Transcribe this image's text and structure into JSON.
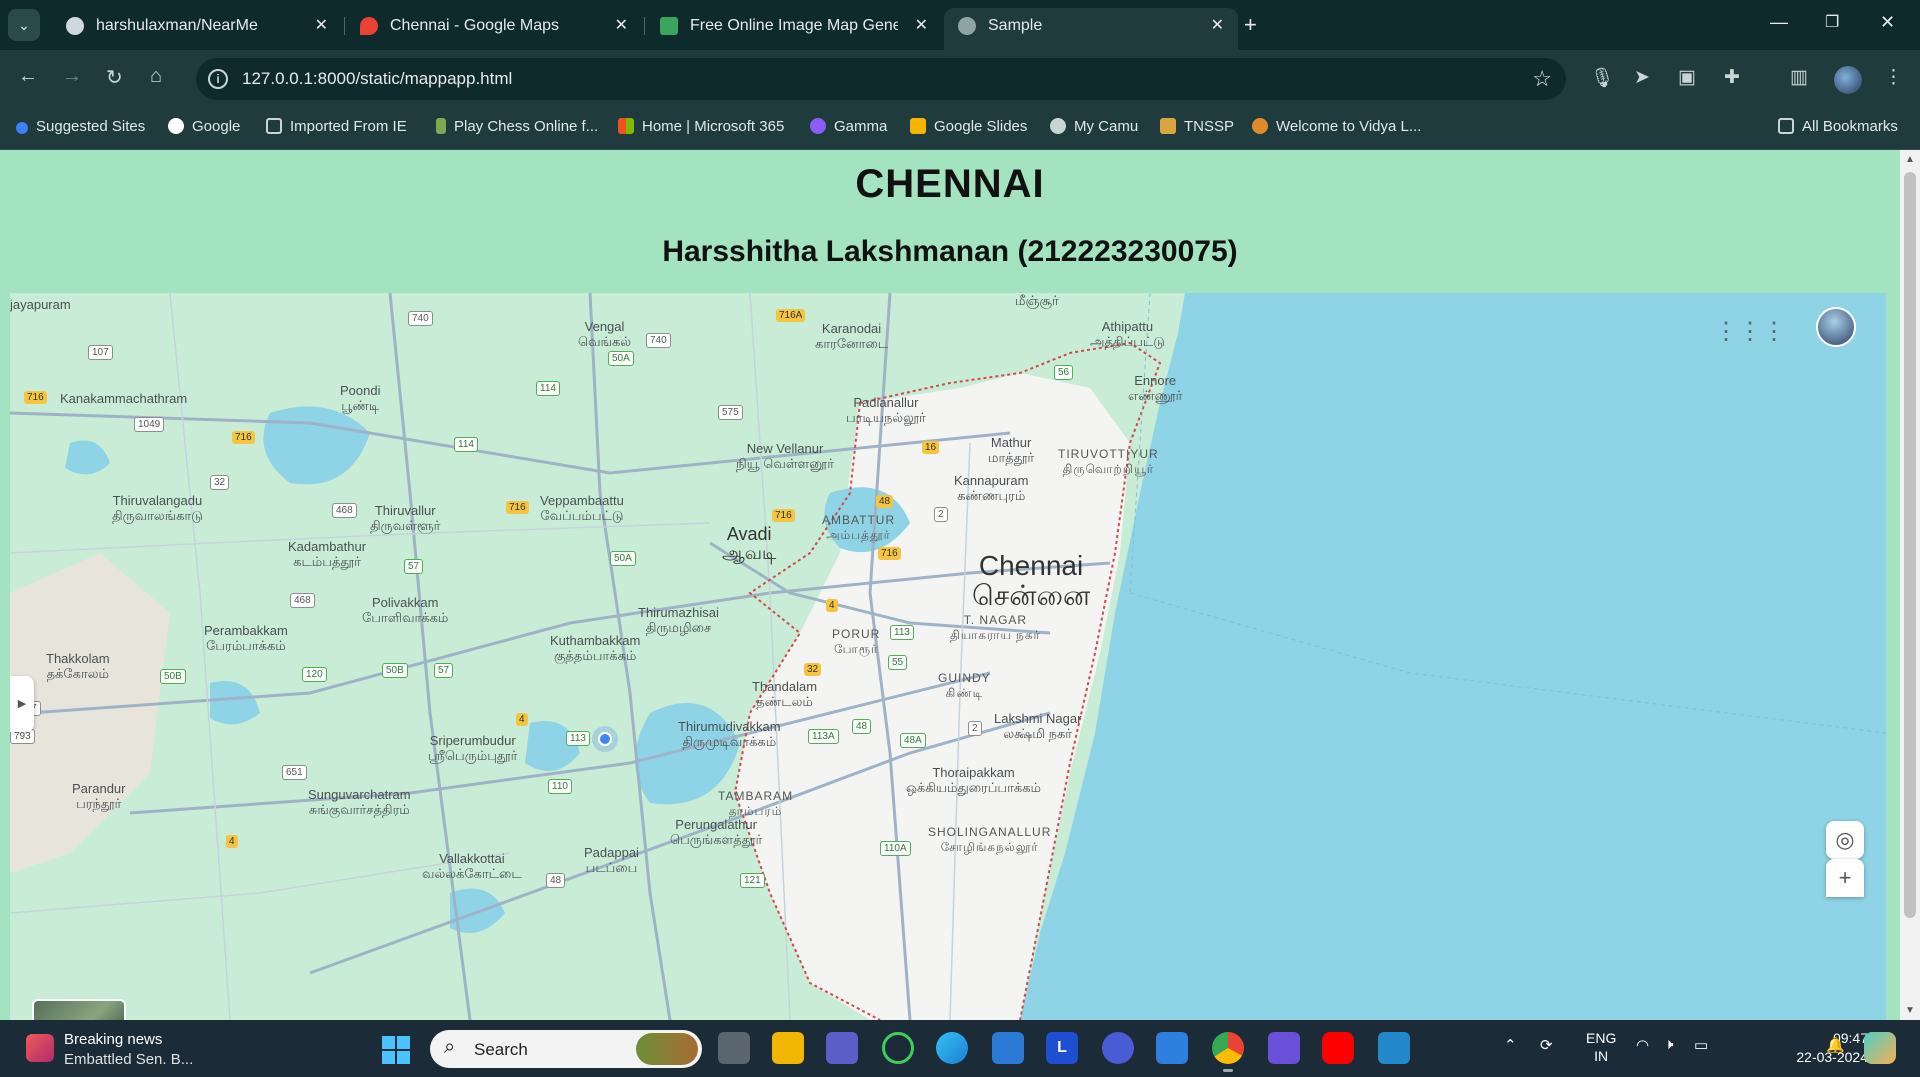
{
  "browser": {
    "tabs": [
      {
        "title": "harshulaxman/NearMe",
        "icon": "github-icon",
        "active": false
      },
      {
        "title": "Chennai - Google Maps",
        "icon": "google-maps-icon",
        "active": false
      },
      {
        "title": "Free Online Image Map Genera",
        "icon": "image-map-icon",
        "active": false
      },
      {
        "title": "Sample",
        "icon": "globe-icon",
        "active": true
      }
    ],
    "url": "127.0.0.1:8000/static/mappapp.html",
    "bookmarks": [
      {
        "label": "Suggested Sites",
        "icon": "ie-icon"
      },
      {
        "label": "Google",
        "icon": "google-icon"
      },
      {
        "label": "Imported From IE",
        "icon": "folder-icon"
      },
      {
        "label": "Play Chess Online f...",
        "icon": "chess-icon"
      },
      {
        "label": "Home | Microsoft 365",
        "icon": "microsoft-icon"
      },
      {
        "label": "Gamma",
        "icon": "gamma-icon"
      },
      {
        "label": "Google Slides",
        "icon": "slides-icon"
      },
      {
        "label": "My Camu",
        "icon": "camu-icon"
      },
      {
        "label": "TNSSP",
        "icon": "tnssp-icon"
      },
      {
        "label": "Welcome to Vidya L...",
        "icon": "vidya-icon"
      }
    ],
    "all_bookmarks": "All Bookmarks"
  },
  "page": {
    "title": "CHENNAI",
    "subtitle": "Harsshitha Lakshmanan (212223230075)"
  },
  "map": {
    "city": {
      "name": "Chennai",
      "tamil": "சென்னை"
    },
    "places": [
      {
        "en": "Avadi",
        "ta": "ஆவடி"
      },
      {
        "en": "jayapuram",
        "ta": ""
      },
      {
        "en": "Vengal",
        "ta": "வெங்கல்"
      },
      {
        "en": "Karanodai",
        "ta": "காரனோடை"
      },
      {
        "en": "Athipattu",
        "ta": "அத்திப்பட்டு"
      },
      {
        "en": "Ennore",
        "ta": "எண்ணூர்"
      },
      {
        "en": "Poondi",
        "ta": "பூண்டி"
      },
      {
        "en": "Kanakammachathram",
        "ta": ""
      },
      {
        "en": "Padianallur",
        "ta": "பாடியநல்லூர்"
      },
      {
        "en": "Mathur",
        "ta": "மாத்தூர்"
      },
      {
        "en": "TIRUVOTTIYUR",
        "ta": "திருவொற்றியூர்"
      },
      {
        "en": "New Vellanur",
        "ta": "நியூ வெள்ளனூர்"
      },
      {
        "en": "Kannapuram",
        "ta": "கண்ணபுரம்"
      },
      {
        "en": "Thiruvalangadu",
        "ta": "திருவாலங்காடு"
      },
      {
        "en": "Thiruvallur",
        "ta": "திருவள்ளூர்"
      },
      {
        "en": "Veppambaattu",
        "ta": "வேப்பம்பட்டு"
      },
      {
        "en": "AMBATTUR",
        "ta": "அம்பத்தூர்"
      },
      {
        "en": "Kadambathur",
        "ta": "கடம்பத்தூர்"
      },
      {
        "en": "Polivakkam",
        "ta": "போளிவாக்கம்"
      },
      {
        "en": "Thirumazhisai",
        "ta": "திருமழிசை"
      },
      {
        "en": "Perambakkam",
        "ta": "பேரம்பாக்கம்"
      },
      {
        "en": "Kuthambakkam",
        "ta": "குத்தம்பாக்கம்"
      },
      {
        "en": "PORUR",
        "ta": "போரூர்"
      },
      {
        "en": "T. NAGAR",
        "ta": "தியாகராய நகர்"
      },
      {
        "en": "Thakkolam",
        "ta": "தக்கோலம்"
      },
      {
        "en": "Thandalam",
        "ta": "தண்டலம்"
      },
      {
        "en": "GUINDY",
        "ta": "கிண்டி"
      },
      {
        "en": "Sriperumbudur",
        "ta": "ஸ்ரீபெரும்புதூர்"
      },
      {
        "en": "Thirumudivakkam",
        "ta": "திருமுடிவாக்கம்"
      },
      {
        "en": "Lakshmi Nagar",
        "ta": "லக்ஷ்மி நகர்"
      },
      {
        "en": "Parandur",
        "ta": "பரந்தூர்"
      },
      {
        "en": "Sunguvarchatram",
        "ta": "சுங்குவார்சத்திரம்"
      },
      {
        "en": "Thoraipakkam",
        "ta": "ஒக்கியம்துரைப்பாக்கம்"
      },
      {
        "en": "TAMBARAM",
        "ta": "தாம்பரம்"
      },
      {
        "en": "Perungalathur",
        "ta": "பெருங்களத்தூர்"
      },
      {
        "en": "SHOLINGANALLUR",
        "ta": "சோழிங்கநல்லூர்"
      },
      {
        "en": "Vallakkottai",
        "ta": "வல்லக்கோட்டை"
      },
      {
        "en": "Padappai",
        "ta": "படப்பை"
      },
      {
        "en": "மீஞ்சூர்",
        "ta": ""
      }
    ],
    "shields": [
      "740",
      "740",
      "107",
      "716",
      "1049",
      "716",
      "114",
      "114",
      "575",
      "716A",
      "50A",
      "50A",
      "56",
      "16",
      "32",
      "468",
      "716",
      "716",
      "48",
      "2",
      "716",
      "57",
      "468",
      "4",
      "113",
      "55",
      "32",
      "120",
      "50B",
      "57",
      "50B",
      "577",
      "4",
      "113",
      "651",
      "110",
      "793",
      "113A",
      "48",
      "48A",
      "2",
      "4",
      "121",
      "48",
      "110A"
    ]
  },
  "taskbar": {
    "news_title": "Breaking news",
    "news_sub": "Embattled Sen. B...",
    "search": "Search",
    "lang1": "ENG",
    "lang2": "IN",
    "time": "09:47",
    "date": "22-03-2024"
  }
}
